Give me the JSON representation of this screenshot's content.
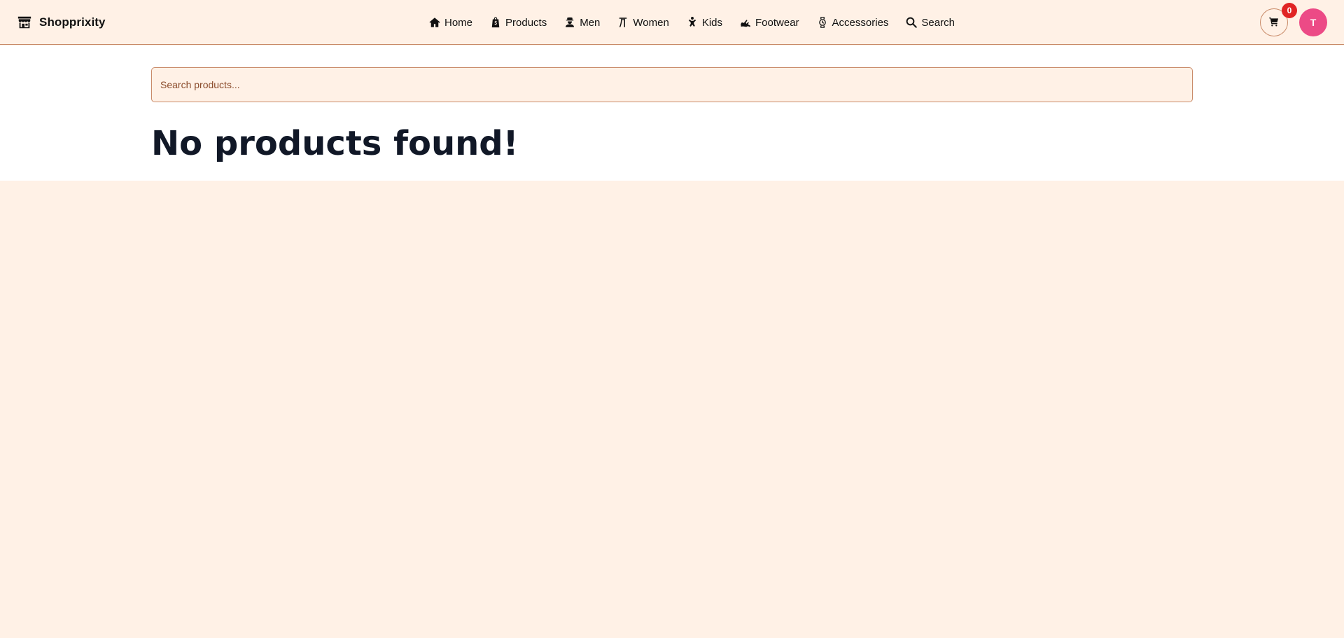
{
  "brand": {
    "name": "Shopprixity",
    "icon": "storefront-icon"
  },
  "nav": {
    "items": [
      {
        "label": "Home",
        "icon": "home-icon"
      },
      {
        "label": "Products",
        "icon": "shopping-bag-icon"
      },
      {
        "label": "Men",
        "icon": "man-icon"
      },
      {
        "label": "Women",
        "icon": "woman-icon"
      },
      {
        "label": "Kids",
        "icon": "child-icon"
      },
      {
        "label": "Footwear",
        "icon": "shoe-icon"
      },
      {
        "label": "Accessories",
        "icon": "watch-icon"
      },
      {
        "label": "Search",
        "icon": "search-icon"
      }
    ]
  },
  "cart": {
    "count": "0",
    "icon": "cart-icon"
  },
  "user": {
    "initial": "T",
    "avatar_color": "#ec4a86"
  },
  "search": {
    "placeholder": "Search products...",
    "value": ""
  },
  "main": {
    "empty_message": "No products found!"
  },
  "colors": {
    "background": "#fff1e6",
    "border": "#c98a68",
    "badge": "#e02424",
    "content_background": "#ffffff"
  }
}
